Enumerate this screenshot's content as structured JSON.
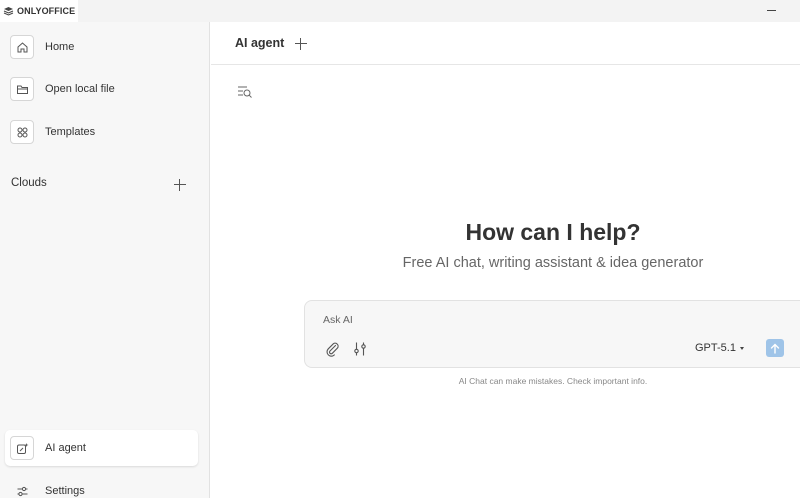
{
  "window": {
    "brand": "ONLYOFFICE"
  },
  "sidebar": {
    "items": [
      {
        "label": "Home",
        "icon": "home-icon"
      },
      {
        "label": "Open local file",
        "icon": "folder-icon"
      },
      {
        "label": "Templates",
        "icon": "templates-icon"
      }
    ],
    "clouds_label": "Clouds",
    "bottom": [
      {
        "label": "AI agent",
        "icon": "ai-agent-icon",
        "active": true
      },
      {
        "label": "Settings",
        "icon": "sliders-icon"
      }
    ]
  },
  "main": {
    "tab_title": "AI agent",
    "headline": "How can I help?",
    "subline": "Free AI chat, writing assistant & idea generator",
    "chat": {
      "placeholder": "Ask AI",
      "model": "GPT-5.1",
      "disclaimer": "AI Chat can make mistakes. Check important info."
    }
  },
  "colors": {
    "accent": "#9fc4e8",
    "sidebar_bg": "#f7f7f7"
  }
}
